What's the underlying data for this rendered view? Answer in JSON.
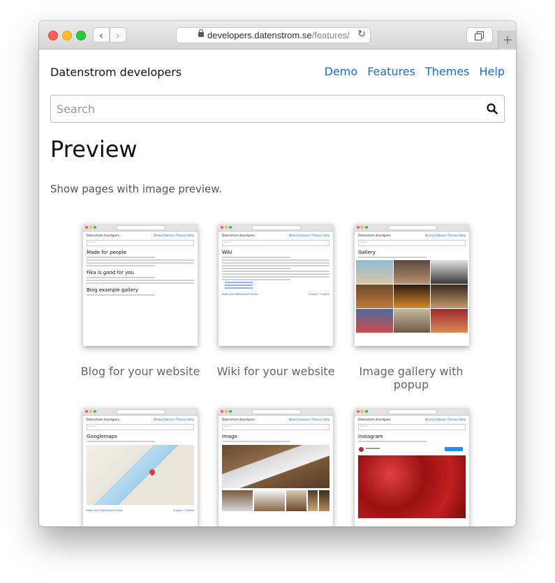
{
  "browser": {
    "url_main": "developers.datenstrom.se",
    "url_path": "/features/"
  },
  "site": {
    "name": "Datenstrom developers",
    "menu": [
      "Demo",
      "Features",
      "Themes",
      "Help"
    ]
  },
  "search": {
    "placeholder": "Search"
  },
  "page": {
    "title": "Preview",
    "description": "Show pages with image preview."
  },
  "thumbs": [
    {
      "caption": "Blog for your website",
      "header": "Made for people",
      "h2": "Fika is good for you",
      "h3": "Blog example gallery"
    },
    {
      "caption": "Wiki for your website",
      "header": "Wiki",
      "footer_left": "Made with Datenstrom Yellow",
      "footer_right": "Support · English"
    },
    {
      "caption": "Image gallery with popup",
      "header": "Gallery"
    },
    {
      "caption": "",
      "header": "Googlemaps",
      "footer_left": "Made with Datenstrom Yellow",
      "footer_right": "Support · English"
    },
    {
      "caption": "",
      "header": "Image"
    },
    {
      "caption": "",
      "header": "Instagram"
    }
  ],
  "thumb_common": {
    "site": "Datenstrom developers",
    "menu": "Demo  Features  Themes  Help",
    "search": "Search"
  },
  "colors": {
    "link": "#1a6bd9",
    "traffic_red": "#fc5f57",
    "traffic_yellow": "#fdbc2e",
    "traffic_green": "#29c940"
  }
}
